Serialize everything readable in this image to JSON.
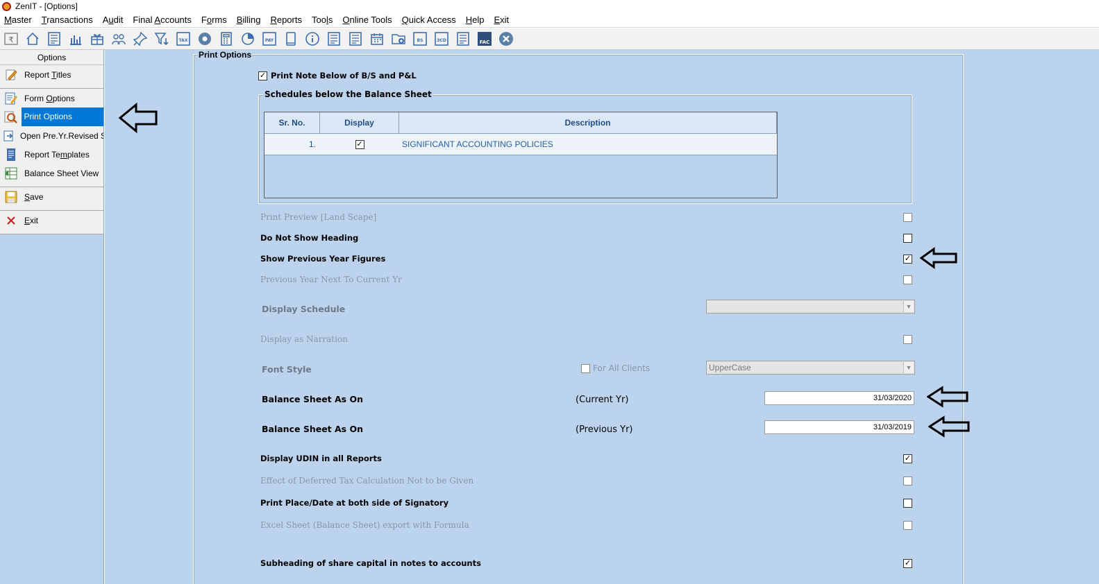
{
  "window": {
    "title": "ZenIT - [Options]"
  },
  "menu": [
    {
      "label": "Master",
      "u": "M",
      "rest": "aster"
    },
    {
      "label": "Transactions",
      "u": "T",
      "rest": "ransactions"
    },
    {
      "label": "Audit",
      "pre": "A",
      "u": "u",
      "rest": "dit"
    },
    {
      "label": "Final Accounts",
      "pre": "Final ",
      "u": "A",
      "rest": "ccounts"
    },
    {
      "label": "Forms",
      "pre": "F",
      "u": "o",
      "rest": "rms"
    },
    {
      "label": "Billing",
      "u": "B",
      "rest": "illing"
    },
    {
      "label": "Reports",
      "u": "R",
      "rest": "eports"
    },
    {
      "label": "Tools",
      "pre": "Too",
      "u": "l",
      "rest": "s"
    },
    {
      "label": "Online Tools",
      "u": "O",
      "rest": "nline Tools"
    },
    {
      "label": "Quick Access",
      "u": "Q",
      "rest": "uick Access"
    },
    {
      "label": "Help",
      "u": "H",
      "rest": "elp"
    },
    {
      "label": "Exit",
      "u": "E",
      "rest": "xit"
    }
  ],
  "toolbar_icons": [
    "rupee-book-icon",
    "home-icon",
    "building-icon",
    "bar-chart-icon",
    "gift-icon",
    "users-icon",
    "pin-icon",
    "filter-icon",
    "tax-icon",
    "eye-icon",
    "calculator-icon",
    "pie-chart-icon",
    "pay-icon",
    "book-icon",
    "info-icon",
    "report-icon",
    "clipboard-icon",
    "calendar-icon",
    "folder-add-icon",
    "bs-icon",
    "3cd-icon",
    "document-icon",
    "fac-icon",
    "close-icon"
  ],
  "toolbar_labels": {
    "tax": "TAX",
    "pay": "PAY",
    "bs": "BS",
    "3cd": "3CD",
    "fac": "FAC"
  },
  "left_panel": {
    "header": "Options",
    "items": [
      {
        "label": "Report Titles",
        "icon": "pencil-icon",
        "active": false
      },
      {
        "label": "Form Options",
        "icon": "form-edit-icon",
        "active": false
      },
      {
        "label": "Print Options",
        "icon": "magnifier-icon",
        "active": true
      },
      {
        "label": "Open Pre.Yr.Revised Sch",
        "icon": "open-doc-icon",
        "active": false
      },
      {
        "label": "Report Templates",
        "icon": "template-icon",
        "active": false
      },
      {
        "label": "Balance Sheet View",
        "icon": "sheet-view-icon",
        "active": false
      },
      {
        "label": "Save",
        "icon": "save-icon",
        "active": false
      },
      {
        "label": "Exit",
        "icon": "exit-x-icon",
        "active": false
      }
    ]
  },
  "print_options": {
    "legend": "Print Options",
    "print_note": {
      "label": "Print Note Below of B/S and P&L",
      "checked": true
    },
    "schedules": {
      "legend": "Schedules below the Balance Sheet",
      "columns": [
        "Sr. No.",
        "Display",
        "Description"
      ],
      "rows": [
        {
          "sr": "1.",
          "display": true,
          "description": "SIGNIFICANT ACCOUNTING POLICIES"
        }
      ]
    },
    "options": [
      {
        "label": "Print Preview [Land Scape]",
        "enabled": false,
        "checked": false
      },
      {
        "label": "Do Not Show Heading",
        "enabled": true,
        "checked": false
      },
      {
        "label": "Show Previous Year Figures",
        "enabled": true,
        "checked": true
      },
      {
        "label": "Previous Year Next To Current Yr",
        "enabled": false,
        "checked": false
      }
    ],
    "display_schedule": {
      "label": "Display Schedule",
      "value": ""
    },
    "display_as_narration": {
      "label": "Display as Narration",
      "checked": false
    },
    "font_style": {
      "label": "Font Style",
      "for_all_clients": "For All Clients",
      "value": "UpperCase"
    },
    "bs_current": {
      "label": "Balance Sheet As On",
      "period": "(Current Yr)",
      "date": "31/03/2020"
    },
    "bs_previous": {
      "label": "Balance Sheet As On",
      "period": "(Previous Yr)",
      "date": "31/03/2019"
    },
    "bottom_options": [
      {
        "label": "Display UDIN in all Reports",
        "enabled": true,
        "checked": true
      },
      {
        "label": "Effect of Deferred Tax Calculation Not to be Given",
        "enabled": false,
        "checked": false
      },
      {
        "label": "Print Place/Date at both side of Signatory",
        "enabled": true,
        "checked": false
      },
      {
        "label": "Excel Sheet (Balance Sheet) export with Formula",
        "enabled": false,
        "checked": false
      },
      {
        "label": "Subheading of share capital in notes to accounts",
        "enabled": true,
        "checked": true
      }
    ]
  }
}
